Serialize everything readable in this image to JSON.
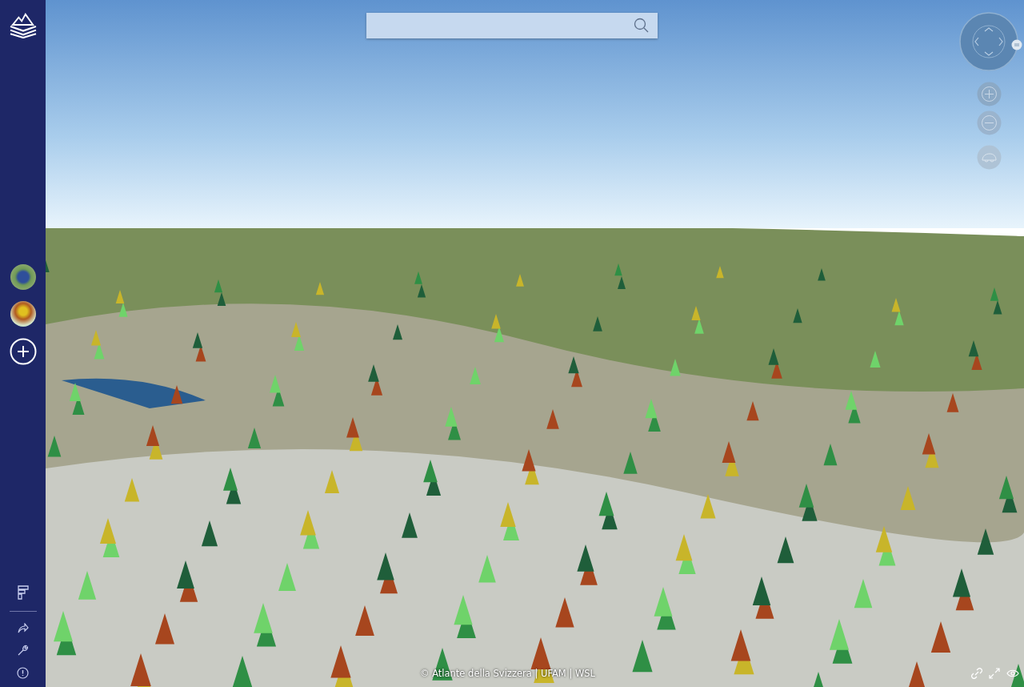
{
  "attribution": "© Atlante della Svizzera | UFAM | WSL"
}
